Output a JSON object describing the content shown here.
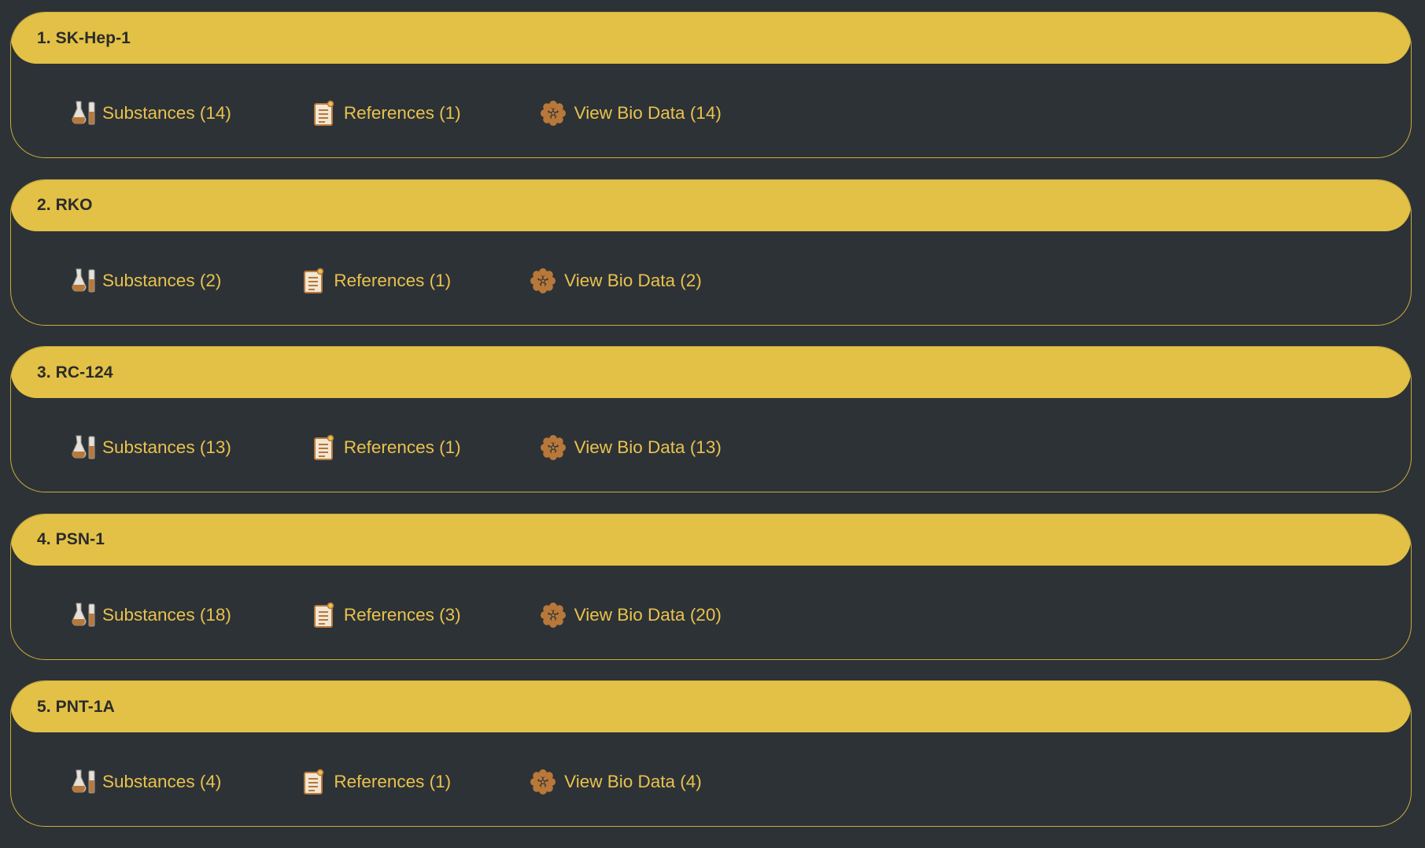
{
  "colors": {
    "background": "#2d3236",
    "header_fill": "#e2c146",
    "card_border": "#c9ac3d",
    "link_text": "#e9c24d",
    "title_text": "#2b2b2b",
    "icon_fill": "#b8783a"
  },
  "icons": {
    "substances": "flask-icon",
    "references": "document-icon",
    "bio_data": "cell-cluster-icon"
  },
  "cells": [
    {
      "title": "1. SK-Hep-1",
      "substances": "Substances (14)",
      "references": "References (1)",
      "bio_data": "View Bio Data (14)"
    },
    {
      "title": "2. RKO",
      "substances": "Substances (2)",
      "references": "References (1)",
      "bio_data": "View Bio Data (2)"
    },
    {
      "title": "3. RC-124",
      "substances": "Substances (13)",
      "references": "References (1)",
      "bio_data": "View Bio Data (13)"
    },
    {
      "title": "4. PSN-1",
      "substances": "Substances (18)",
      "references": "References (3)",
      "bio_data": "View Bio Data (20)"
    },
    {
      "title": "5. PNT-1A",
      "substances": "Substances (4)",
      "references": "References (1)",
      "bio_data": "View Bio Data (4)"
    }
  ]
}
